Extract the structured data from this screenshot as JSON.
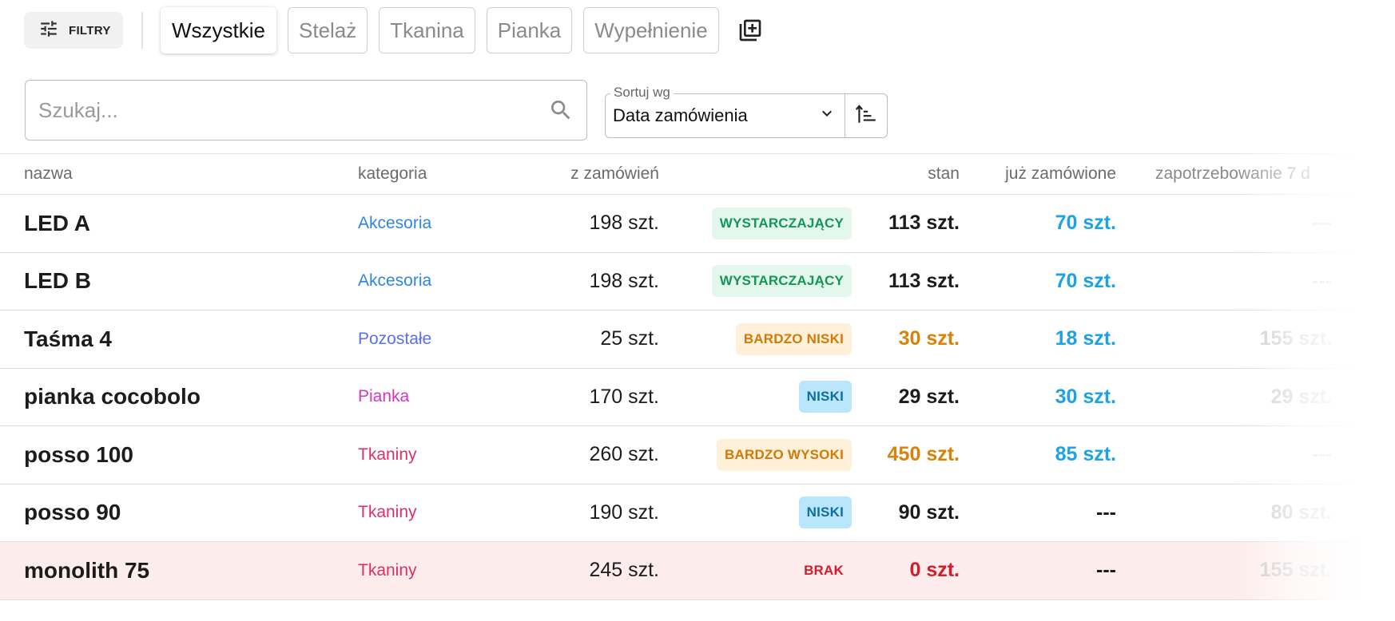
{
  "toolbar": {
    "filters_label": "FILTRY",
    "tabs": [
      {
        "label": "Wszystkie",
        "active": true
      },
      {
        "label": "Stelaż",
        "active": false
      },
      {
        "label": "Tkanina",
        "active": false
      },
      {
        "label": "Pianka",
        "active": false
      },
      {
        "label": "Wypełnienie",
        "active": false
      }
    ],
    "add_group_icon": "library-add-icon"
  },
  "search": {
    "placeholder": "Szukaj...",
    "value": "",
    "icon": "search-icon"
  },
  "sort": {
    "legend": "Sortuj wg",
    "selected": "Data zamówienia",
    "icon": "chevron-down-icon",
    "order_icon": "sort-ascending-icon"
  },
  "table": {
    "headers": {
      "name": "nazwa",
      "category": "kategoria",
      "from_orders": "z zamówień",
      "stock": "stan",
      "already_ordered": "już zamówione",
      "demand": "zapotrzebowanie 7 d"
    },
    "rows": [
      {
        "name": "LED A",
        "category": "Akcesoria",
        "category_color": "#2d86e6",
        "from_orders": "198 szt.",
        "badge": "WYSTARCZAJĄCY",
        "badge_fg": "#14965a",
        "badge_bg": "#e4f7ec",
        "stock": "113 szt.",
        "stock_color": "#1c1c1c",
        "already_ordered": "70 szt.",
        "ordered_color": "#1ba3e3",
        "demand": "---",
        "alert": false
      },
      {
        "name": "LED B",
        "category": "Akcesoria",
        "category_color": "#2d86e6",
        "from_orders": "198 szt.",
        "badge": "WYSTARCZAJĄCY",
        "badge_fg": "#14965a",
        "badge_bg": "#e4f7ec",
        "stock": "113 szt.",
        "stock_color": "#1c1c1c",
        "already_ordered": "70 szt.",
        "ordered_color": "#1ba3e3",
        "demand": "---",
        "alert": false
      },
      {
        "name": "Taśma 4",
        "category": "Pozostałe",
        "category_color": "#5b6ff0",
        "from_orders": "25 szt.",
        "badge": "BARDZO NISKI",
        "badge_fg": "#d07a08",
        "badge_bg": "#fff1d9",
        "stock": "30 szt.",
        "stock_color": "#d98207",
        "already_ordered": "18 szt.",
        "ordered_color": "#1ba3e3",
        "demand": "155 szt.",
        "alert": false
      },
      {
        "name": "pianka cocobolo",
        "category": "Pianka",
        "category_color": "#d633c7",
        "from_orders": "170 szt.",
        "badge": "NISKI",
        "badge_fg": "#0f6f9a",
        "badge_bg": "#b9e6fa",
        "stock": "29 szt.",
        "stock_color": "#1c1c1c",
        "already_ordered": "30 szt.",
        "ordered_color": "#1ba3e3",
        "demand": "29 szt.",
        "alert": false
      },
      {
        "name": "posso 100",
        "category": "Tkaniny",
        "category_color": "#dc2f64",
        "from_orders": "260 szt.",
        "badge": "BARDZO WYSOKI",
        "badge_fg": "#d07a08",
        "badge_bg": "#fff1d9",
        "stock": "450 szt.",
        "stock_color": "#d98207",
        "already_ordered": "85 szt.",
        "ordered_color": "#1ba3e3",
        "demand": "---",
        "alert": false
      },
      {
        "name": "posso 90",
        "category": "Tkaniny",
        "category_color": "#dc2f64",
        "from_orders": "190 szt.",
        "badge": "NISKI",
        "badge_fg": "#0f6f9a",
        "badge_bg": "#b9e6fa",
        "stock": "90 szt.",
        "stock_color": "#1c1c1c",
        "already_ordered": "---",
        "ordered_color": "#1c1c1c",
        "demand": "80 szt.",
        "alert": false
      },
      {
        "name": "monolith 75",
        "category": "Tkaniny",
        "category_color": "#dc2f64",
        "from_orders": "245 szt.",
        "badge": "BRAK",
        "badge_fg": "#d41c2a",
        "badge_bg": "transparent",
        "stock": "0 szt.",
        "stock_color": "#d41c2a",
        "already_ordered": "---",
        "ordered_color": "#1c1c1c",
        "demand": "155 szt.",
        "alert": true
      }
    ]
  }
}
